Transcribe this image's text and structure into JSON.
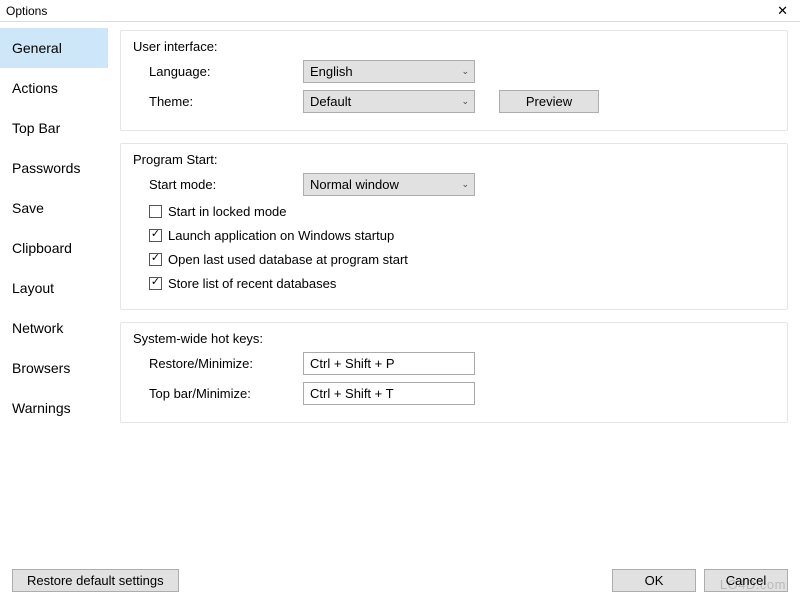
{
  "window": {
    "title": "Options"
  },
  "sidebar": {
    "items": [
      {
        "label": "General",
        "active": true
      },
      {
        "label": "Actions"
      },
      {
        "label": "Top Bar"
      },
      {
        "label": "Passwords"
      },
      {
        "label": "Save"
      },
      {
        "label": "Clipboard"
      },
      {
        "label": "Layout"
      },
      {
        "label": "Network"
      },
      {
        "label": "Browsers"
      },
      {
        "label": "Warnings"
      }
    ]
  },
  "ui_group": {
    "title": "User interface:",
    "language_label": "Language:",
    "language_value": "English",
    "theme_label": "Theme:",
    "theme_value": "Default",
    "preview_button": "Preview"
  },
  "start_group": {
    "title": "Program Start:",
    "mode_label": "Start mode:",
    "mode_value": "Normal window",
    "locked_label": "Start in locked mode",
    "locked_checked": false,
    "launch_label": "Launch application on Windows startup",
    "launch_checked": true,
    "openlast_label": "Open last used database at program start",
    "openlast_checked": true,
    "recent_label": "Store list of recent databases",
    "recent_checked": true
  },
  "hotkeys_group": {
    "title": "System-wide hot keys:",
    "restore_label": "Restore/Minimize:",
    "restore_value": "Ctrl + Shift + P",
    "topbar_label": "Top bar/Minimize:",
    "topbar_value": "Ctrl + Shift + T"
  },
  "footer": {
    "restore_defaults": "Restore default settings",
    "ok": "OK",
    "cancel": "Cancel"
  },
  "watermark": "LO4D.com"
}
